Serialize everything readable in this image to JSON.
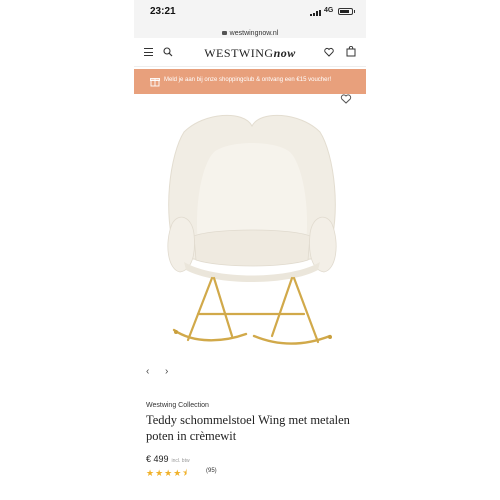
{
  "status": {
    "time": "23:21",
    "network": "4G"
  },
  "browser": {
    "url": "westwingnow.nl"
  },
  "header": {
    "brand": "WESTWING",
    "brand_suffix": "now"
  },
  "promo": {
    "text": "Meld je aan bij onze shoppingclub & ontvang een €15 voucher!"
  },
  "product": {
    "collection": "Westwing Collection",
    "title": "Teddy schommelstoel Wing met metalen poten in crèmewit",
    "price": "€ 499",
    "price_note": "incl. btw",
    "rating": 4.5,
    "rating_stars": "★★★★⯨",
    "reviews": "(95)"
  },
  "colors": {
    "promo_bg": "#e8a07c",
    "star": "#f0b12a",
    "fabric": "#f2efe8",
    "metal": "#d1a94a"
  },
  "icons": [
    "menu-icon",
    "search-icon",
    "heart-icon",
    "bag-icon",
    "gift-icon",
    "wishlist-heart-icon",
    "chevron-left-icon",
    "chevron-right-icon",
    "lock-icon"
  ]
}
